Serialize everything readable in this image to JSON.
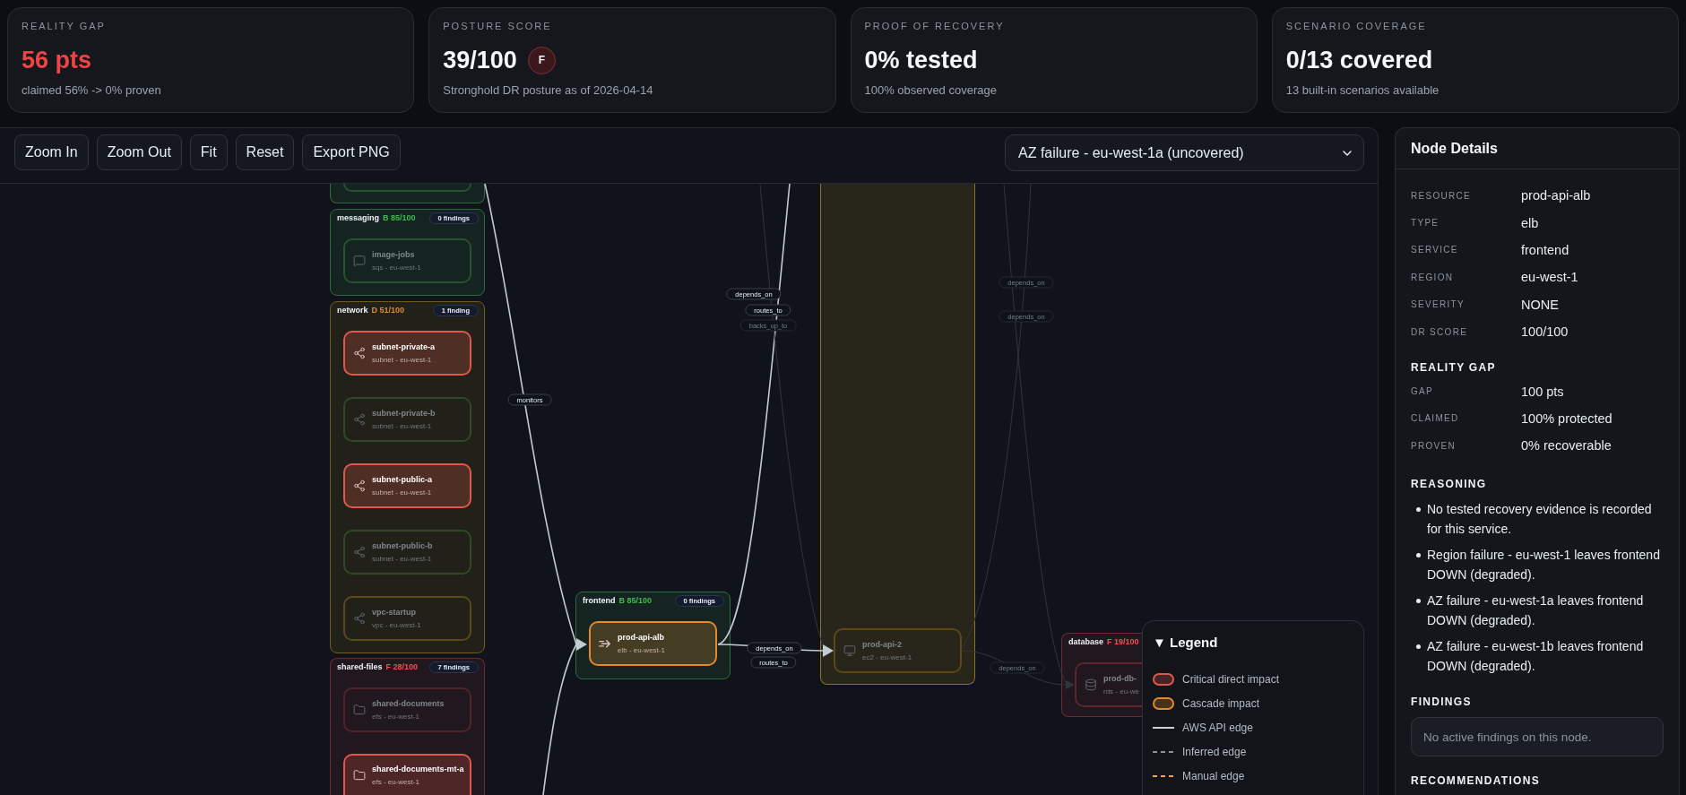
{
  "metrics": [
    {
      "label": "REALITY GAP",
      "value": "56 pts",
      "alert": true,
      "note": "claimed 56% -> 0% proven"
    },
    {
      "label": "POSTURE SCORE",
      "value": "39/100",
      "alert": false,
      "badge": "F",
      "note": "Stronghold DR posture as of 2026-04-14"
    },
    {
      "label": "PROOF OF RECOVERY",
      "value": "0% tested",
      "alert": false,
      "note": "100% observed coverage"
    },
    {
      "label": "SCENARIO COVERAGE",
      "value": "0/13 covered",
      "alert": false,
      "note": "13 built-in scenarios available"
    }
  ],
  "toolbar": {
    "buttons": [
      "Zoom In",
      "Zoom Out",
      "Fit",
      "Reset",
      "Export PNG"
    ],
    "scenario": {
      "value": "AZ failure - eu-west-1a (uncovered)"
    }
  },
  "graph": {
    "groups": [
      {
        "color": "#2d6b3f",
        "nodes": [
          {
            "color": "#25522f"
          }
        ]
      },
      {
        "name": "messaging",
        "score": {
          "text": "B 85/100",
          "color": "#3fb950"
        },
        "findings": "0 findings",
        "color": "#2d6b3f",
        "nodes": [
          {
            "kind": "sqs",
            "title": "image-jobs",
            "subtitle": "sqs - eu-west-1",
            "impacted": false,
            "color": "#25522f"
          }
        ]
      },
      {
        "name": "network",
        "score": {
          "text": "D 51/100",
          "color": "#e08a2c"
        },
        "findings": "1 finding",
        "color": "#6e5c1a",
        "nodes": [
          {
            "kind": "subnet",
            "title": "subnet-private-a",
            "subtitle": "subnet - eu-west-1",
            "impacted": true,
            "color": "#e2574c"
          },
          {
            "kind": "subnet",
            "title": "subnet-private-b",
            "subtitle": "subnet - eu-west-1",
            "impacted": false,
            "color": "#2c4a26"
          },
          {
            "kind": "subnet",
            "title": "subnet-public-a",
            "subtitle": "subnet - eu-west-1",
            "impacted": true,
            "color": "#e2574c"
          },
          {
            "kind": "subnet",
            "title": "subnet-public-b",
            "subtitle": "subnet - eu-west-1",
            "impacted": false,
            "color": "#2c4a26"
          },
          {
            "kind": "subnet",
            "title": "vpc-startup",
            "subtitle": "vpc - eu-west-1",
            "impacted": false,
            "color": "#5a4a18"
          }
        ]
      },
      {
        "name": "shared-files",
        "score": {
          "text": "F 28/100",
          "color": "#f0524f"
        },
        "findings": "7 findings",
        "color": "#6b2a31",
        "nodes": [
          {
            "kind": "efs",
            "title": "shared-documents",
            "subtitle": "efs - eu-west-1",
            "impacted": false,
            "color": "#55242b"
          },
          {
            "kind": "efs",
            "title": "shared-documents-mt-a",
            "subtitle": "efs - eu-west-1",
            "impacted": true,
            "color": "#e2574c"
          }
        ]
      },
      {
        "name": "frontend",
        "score": {
          "text": "B 85/100",
          "color": "#3fb950"
        },
        "findings": "0 findings",
        "color": "#2d6b3f",
        "nodes": [
          {
            "kind": "elb",
            "title": "prod-api-alb",
            "subtitle": "elb - eu-west-1",
            "impacted": true,
            "color": "#e3892c"
          }
        ]
      },
      {
        "color": "#8a7520",
        "nodes": [
          {
            "kind": "ec2",
            "title": "prod-api-2",
            "subtitle": "ec2 - eu-west-1",
            "impacted": false,
            "color": "#5e4619"
          }
        ]
      },
      {
        "name": "database",
        "score": {
          "text": "F 19/100",
          "color": "#f0524f"
        },
        "color": "#6b2a31",
        "nodes": [
          {
            "kind": "rds",
            "title": "prod-db-",
            "subtitle": "rds - eu-we",
            "impacted": false,
            "color": "#5e262d"
          }
        ]
      }
    ],
    "edges": [
      {
        "labels": [
          "monitors"
        ],
        "active": true
      },
      {
        "active": true
      },
      {
        "labels": [
          "depends_on",
          "routes_to"
        ],
        "active": true
      },
      {
        "labels": [
          "backs_up_to"
        ],
        "active": false
      },
      {
        "labels": [
          "depends_on"
        ],
        "active": false
      },
      {
        "labels": [
          "depends_on"
        ],
        "active": false
      },
      {
        "labels": [
          "depends_on",
          "routes_to"
        ],
        "active": true
      },
      {
        "labels": [
          "depends_on"
        ],
        "active": false
      }
    ],
    "legend": {
      "title": "▼ Legend",
      "items": [
        {
          "kind": "swatch",
          "color": "#e2574c",
          "label": "Critical direct impact"
        },
        {
          "kind": "swatch",
          "color": "#e3892c",
          "label": "Cascade impact"
        },
        {
          "kind": "solid",
          "color": "#c9d1d9",
          "label": "AWS API edge"
        },
        {
          "kind": "dashed",
          "color": "#8b949e",
          "label": "Inferred edge"
        },
        {
          "kind": "dashed",
          "color": "#f0a35e",
          "label": "Manual edge"
        }
      ]
    }
  },
  "details": {
    "title": "Node Details",
    "sections": [
      {
        "kind": "fields",
        "fields": [
          {
            "label": "RESOURCE",
            "value": "prod-api-alb"
          },
          {
            "label": "TYPE",
            "value": "elb"
          },
          {
            "label": "SERVICE",
            "value": "frontend"
          },
          {
            "label": "REGION",
            "value": "eu-west-1"
          },
          {
            "label": "SEVERITY",
            "value": "NONE"
          },
          {
            "label": "DR SCORE",
            "value": "100/100"
          }
        ]
      },
      {
        "kind": "fields",
        "heading": "REALITY GAP",
        "fields": [
          {
            "label": "GAP",
            "value": "100 pts"
          },
          {
            "label": "CLAIMED",
            "value": "100% protected"
          },
          {
            "label": "PROVEN",
            "value": "0% recoverable"
          }
        ]
      },
      {
        "kind": "list",
        "heading": "REASONING",
        "items": [
          "No tested recovery evidence is recorded for this service.",
          "Region failure - eu-west-1 leaves frontend DOWN (degraded).",
          "AZ failure - eu-west-1a leaves frontend DOWN (degraded).",
          "AZ failure - eu-west-1b leaves frontend DOWN (degraded)."
        ]
      },
      {
        "kind": "note",
        "heading": "FINDINGS",
        "text": "No active findings on this node."
      },
      {
        "kind": "list",
        "heading": "RECOMMENDATIONS"
      }
    ]
  }
}
